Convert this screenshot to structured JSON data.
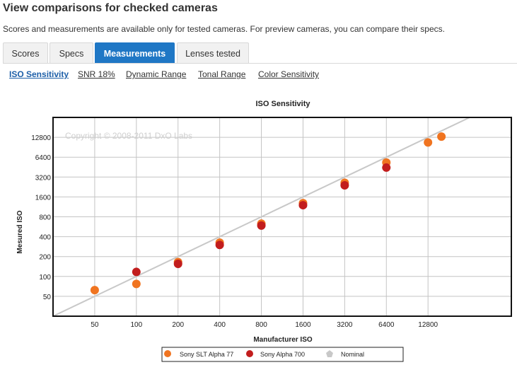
{
  "header": {
    "title": "View comparisons for checked cameras",
    "subtitle": "Scores and measurements are available only for tested cameras. For preview cameras, you can compare their specs."
  },
  "tabs": [
    {
      "label": "Scores",
      "active": false
    },
    {
      "label": "Specs",
      "active": false
    },
    {
      "label": "Measurements",
      "active": true
    },
    {
      "label": "Lenses tested",
      "active": false
    }
  ],
  "subnav": [
    {
      "label": "ISO Sensitivity",
      "active": true
    },
    {
      "label": "SNR 18%",
      "active": false
    },
    {
      "label": "Dynamic Range",
      "active": false
    },
    {
      "label": "Tonal Range",
      "active": false
    },
    {
      "label": "Color Sensitivity",
      "active": false
    }
  ],
  "colors": {
    "accent": "#1f77c5",
    "series1": "#f07420",
    "series2": "#c21d1d",
    "nominal": "#c8c8c8"
  },
  "chart_data": {
    "type": "scatter",
    "title": "ISO Sensitivity",
    "xlabel": "Manufacturer ISO",
    "ylabel": "Mesured ISO",
    "watermark": "Copyright © 2008-2011 DxO Labs",
    "scale": "log2",
    "grid": true,
    "legend_position": "bottom",
    "x_ticks": [
      50,
      100,
      200,
      400,
      800,
      1600,
      3200,
      6400,
      12800
    ],
    "y_ticks": [
      50,
      100,
      200,
      400,
      800,
      1600,
      3200,
      6400,
      12800
    ],
    "xlim": [
      25,
      51200
    ],
    "ylim": [
      25,
      25600
    ],
    "series": [
      {
        "name": "Sony SLT Alpha 77",
        "color": "#f07420",
        "points": [
          [
            50,
            62
          ],
          [
            100,
            77
          ],
          [
            200,
            165
          ],
          [
            400,
            325
          ],
          [
            800,
            630
          ],
          [
            1600,
            1290
          ],
          [
            3200,
            2620
          ],
          [
            6400,
            5320
          ],
          [
            12800,
            10700
          ],
          [
            16000,
            13100
          ]
        ]
      },
      {
        "name": "Sony Alpha 700",
        "color": "#c21d1d",
        "points": [
          [
            100,
            117
          ],
          [
            200,
            155
          ],
          [
            400,
            300
          ],
          [
            800,
            590
          ],
          [
            1600,
            1200
          ],
          [
            3200,
            2400
          ],
          [
            6400,
            4450
          ]
        ]
      },
      {
        "name": "Nominal",
        "color": "#c8c8c8",
        "line": [
          [
            25,
            25
          ],
          [
            25600,
            25600
          ]
        ]
      }
    ]
  }
}
